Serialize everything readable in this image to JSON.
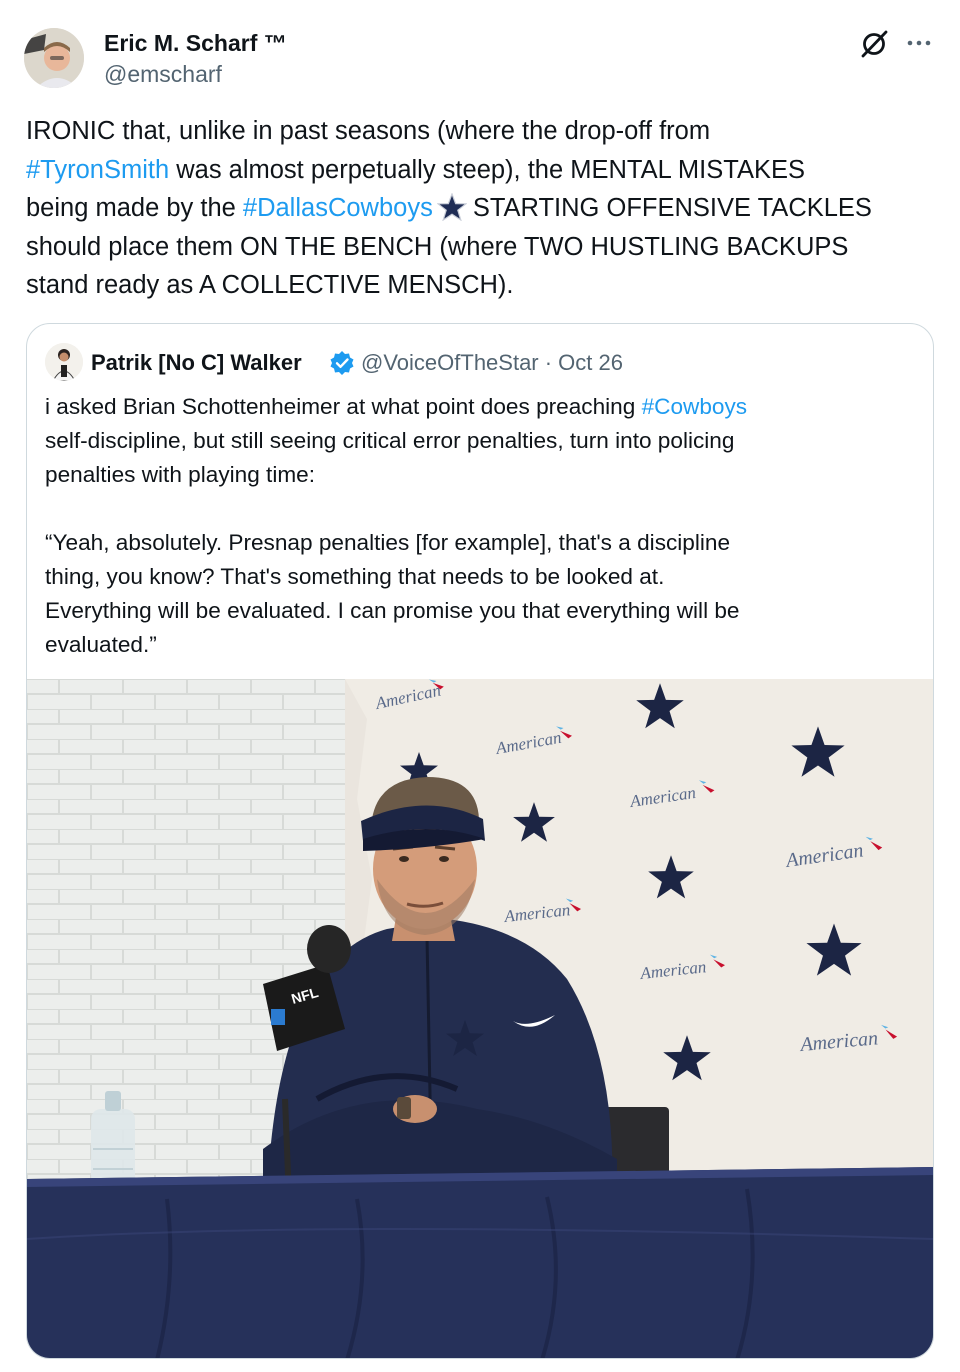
{
  "author": {
    "name": "Eric M. Scharf ™",
    "handle": "@emscharf",
    "avatar_icon": "profile-photo"
  },
  "header_icons": [
    "grok-icon",
    "more-icon"
  ],
  "tweet": {
    "lines": [
      {
        "pre": "IRONIC that, unlike in past seasons (where the drop-off from",
        "tag": "",
        "post": ""
      },
      {
        "pre": "",
        "tag": "#TyronSmith",
        "post": " was almost perpetually steep), the MENTAL MISTAKES"
      },
      {
        "pre": "being made by the ",
        "tag": "#DallasCowboys",
        "post": "STARTING OFFENSIVE TACKLES"
      },
      {
        "pre": "should place them ON THE BENCH (where TWO HUSTLING BACKUPS",
        "tag": "",
        "post": ""
      },
      {
        "pre": "stand ready as A COLLECTIVE MENSCH).",
        "tag": "",
        "post": ""
      }
    ],
    "emoji": "star-emoji"
  },
  "quote": {
    "name": "Patrik [No C] Walker",
    "verified": true,
    "handle_date": "@VoiceOfTheStar · Oct 26",
    "lines": [
      {
        "pre": "i asked Brian Schottenheimer at what point does preaching ",
        "tag": "#Cowboys"
      },
      {
        "pre": "self-discipline, but still seeing critical error penalties, turn into policing",
        "tag": ""
      },
      {
        "pre": "penalties with playing time:",
        "tag": ""
      },
      {
        "pre": "",
        "tag": ""
      },
      {
        "pre": "“Yeah, absolutely. Presnap penalties [for example], that's a discipline",
        "tag": ""
      },
      {
        "pre": "thing, you know? That's something that needs to be looked at.",
        "tag": ""
      },
      {
        "pre": "Everything will be evaluated. I can promise you that everything will be",
        "tag": ""
      },
      {
        "pre": "evaluated.”",
        "tag": ""
      }
    ],
    "media": {
      "description_icon": "press-conference-photo",
      "backdrop_text": "American",
      "mic_flag_text": "NFL",
      "colors": {
        "navy": "#1f2a4a",
        "wall": "#e9ebe8",
        "backdrop": "#f1ede6"
      }
    }
  },
  "colors": {
    "link": "#1d9bf0",
    "text": "#0f1419",
    "muted": "#536471",
    "border": "#cfd9de"
  }
}
